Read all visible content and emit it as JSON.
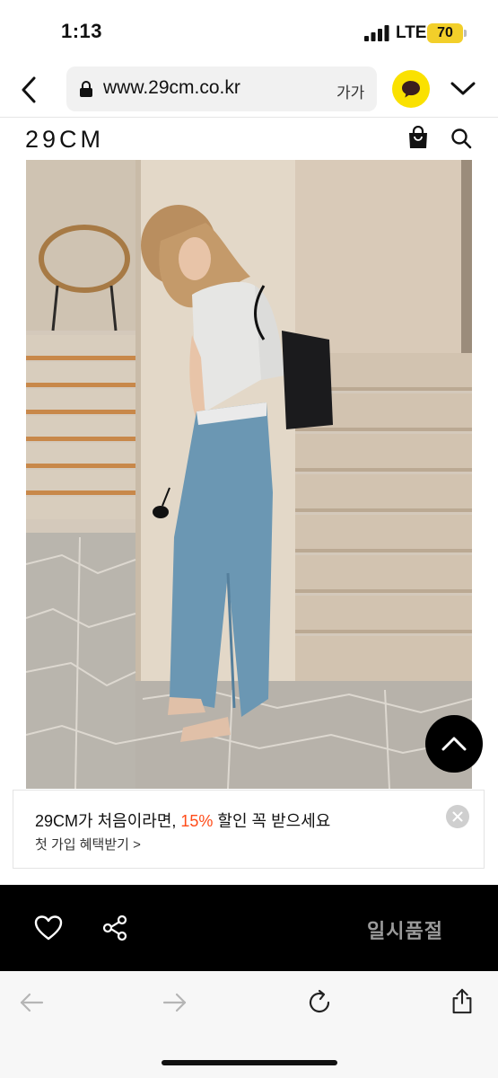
{
  "status_bar": {
    "time": "1:13",
    "network": "LTE",
    "battery": "70"
  },
  "browser": {
    "url": "www.29cm.co.kr",
    "text_size": "가가"
  },
  "site": {
    "logo": "29CM"
  },
  "promo": {
    "title_before": "29CM가 처음이라면, ",
    "title_highlight": "15%",
    "title_after": " 할인 꼭 받으세요",
    "subtitle": "첫 가입 혜택받기 >"
  },
  "product_actions": {
    "status_label": "일시품절"
  },
  "colors": {
    "accent": "#ff4b18",
    "kakao": "#fae100",
    "battery": "#f2cf2a"
  }
}
